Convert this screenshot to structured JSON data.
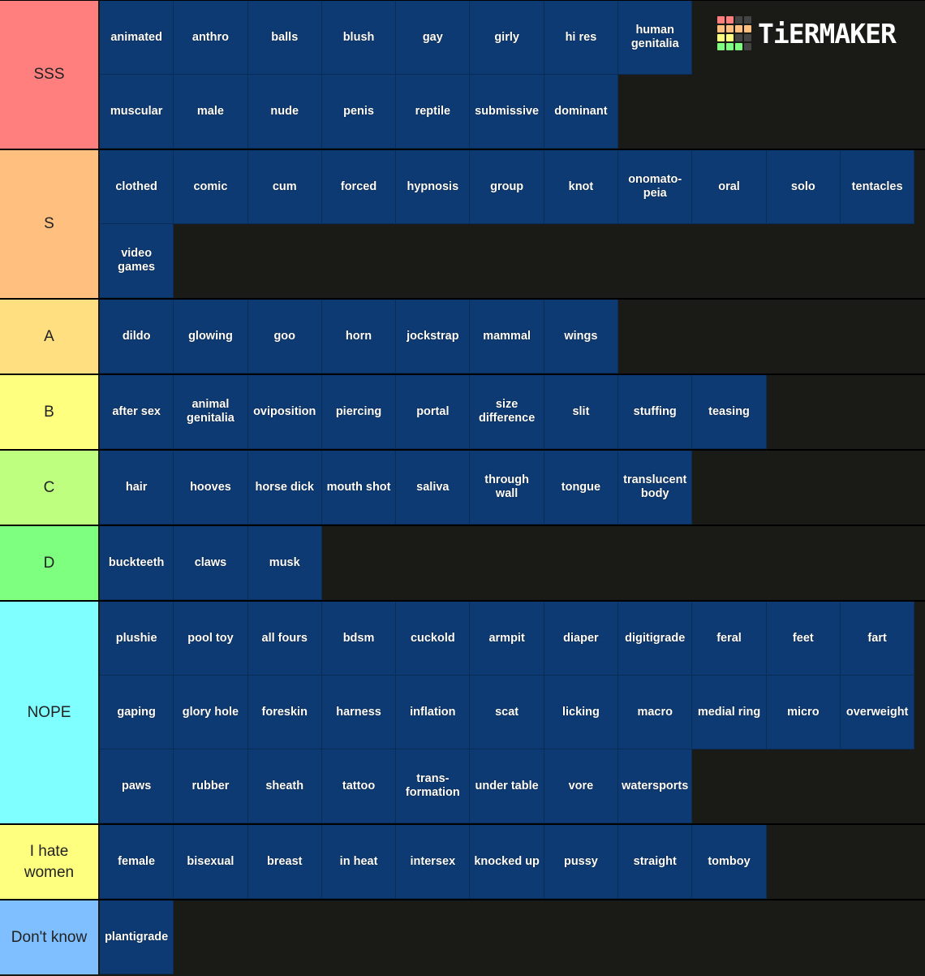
{
  "logo": {
    "text": "TiERMAKER",
    "cells": [
      "#ff7f7f",
      "#ff7f7f",
      "#444",
      "#444",
      "#ffbf7f",
      "#ffbf7f",
      "#ffbf7f",
      "#ffbf7f",
      "#ffff7f",
      "#ffff7f",
      "#444",
      "#444",
      "#7fff7f",
      "#7fff7f",
      "#7fff7f",
      "#444"
    ]
  },
  "colors": {
    "background": "#1a1a17",
    "tile": "#0d3a72"
  },
  "tiers": [
    {
      "label": "SSS",
      "color": "#ff7f7f",
      "items": [
        "animated",
        "anthro",
        "balls",
        "blush",
        "gay",
        "girly",
        "hi res",
        "human\ngenitalia",
        "muscular",
        "male",
        "nude",
        "penis",
        "reptile",
        "submissive",
        "dominant"
      ],
      "break_after": 8
    },
    {
      "label": "S",
      "color": "#ffbf7f",
      "items": [
        "clothed",
        "comic",
        "cum",
        "forced",
        "hypnosis",
        "group",
        "knot",
        "onomato-\npeia",
        "oral",
        "solo",
        "tentacles",
        "video\ngames"
      ]
    },
    {
      "label": "A",
      "color": "#ffdf7f",
      "items": [
        "dildo",
        "glowing",
        "goo",
        "horn",
        "jockstrap",
        "mammal",
        "wings"
      ]
    },
    {
      "label": "B",
      "color": "#ffff7f",
      "items": [
        "after sex",
        "animal\ngenitalia",
        "oviposition",
        "piercing",
        "portal",
        "size\ndifference",
        "slit",
        "stuffing",
        "teasing"
      ]
    },
    {
      "label": "C",
      "color": "#bfff7f",
      "items": [
        "hair",
        "hooves",
        "horse dick",
        "mouth shot",
        "saliva",
        "through\nwall",
        "tongue",
        "translucent\nbody"
      ]
    },
    {
      "label": "D",
      "color": "#7fff7f",
      "items": [
        "buckteeth",
        "claws",
        "musk"
      ]
    },
    {
      "label": "NOPE",
      "color": "#7fffff",
      "items": [
        "plushie",
        "pool toy",
        "all fours",
        "bdsm",
        "cuckold",
        "armpit",
        "diaper",
        "digitigrade",
        "feral",
        "feet",
        "fart",
        "gaping",
        "glory hole",
        "foreskin",
        "harness",
        "inflation",
        "scat",
        "licking",
        "macro",
        "medial ring",
        "micro",
        "overweight",
        "paws",
        "rubber",
        "sheath",
        "tattoo",
        "trans-\nformation",
        "under table",
        "vore",
        "watersports"
      ]
    },
    {
      "label": "I hate women",
      "color": "#ffff7f",
      "items": [
        "female",
        "bisexual",
        "breast",
        "in heat",
        "intersex",
        "knocked up",
        "pussy",
        "straight",
        "tomboy"
      ]
    },
    {
      "label": "Don't know",
      "color": "#7fbfff",
      "items": [
        "plantigrade"
      ]
    }
  ]
}
